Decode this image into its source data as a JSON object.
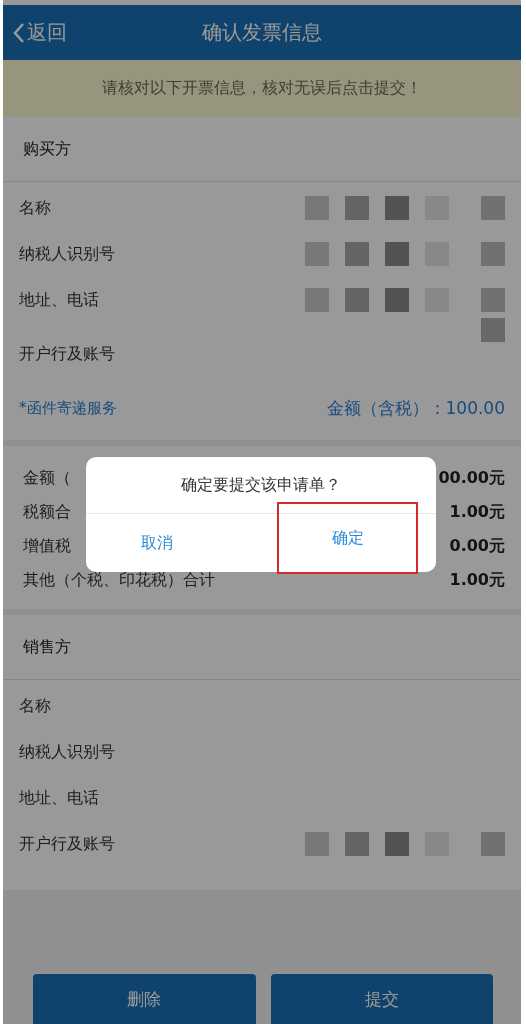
{
  "header": {
    "back": "返回",
    "title": "确认发票信息"
  },
  "notice": "请核对以下开票信息，核对无误后点击提交！",
  "buyer": {
    "title": "购买方",
    "rows": [
      {
        "label": "名称",
        "kind": "masked"
      },
      {
        "label": "纳税人识别号",
        "kind": "masked"
      },
      {
        "label": "地址、电话",
        "kind": "wrapped"
      },
      {
        "label": "开户行及账号",
        "kind": "plain"
      }
    ],
    "service": {
      "label": "*函件寄递服务",
      "amount": "金额（含税）：100.00"
    }
  },
  "totals": [
    {
      "label": "金额（",
      "value": "00.00元"
    },
    {
      "label": "税额合",
      "value": "1.00元"
    },
    {
      "label": "增值税",
      "value": "0.00元"
    },
    {
      "label": "其他（个税、印花税）合计",
      "value": "1.00元"
    }
  ],
  "seller": {
    "title": "销售方",
    "rows": [
      {
        "label": "名称",
        "kind": "plain"
      },
      {
        "label": "纳税人识别号",
        "kind": "plain"
      },
      {
        "label": "地址、电话",
        "kind": "plain"
      },
      {
        "label": "开户行及账号",
        "kind": "masked"
      }
    ]
  },
  "buttons": [
    "删除",
    "提交"
  ],
  "dialog": {
    "message": "确定要提交该申请单？",
    "buttons": [
      {
        "label": "取消",
        "highlighted": false
      },
      {
        "label": "确定",
        "highlighted": true
      }
    ]
  }
}
